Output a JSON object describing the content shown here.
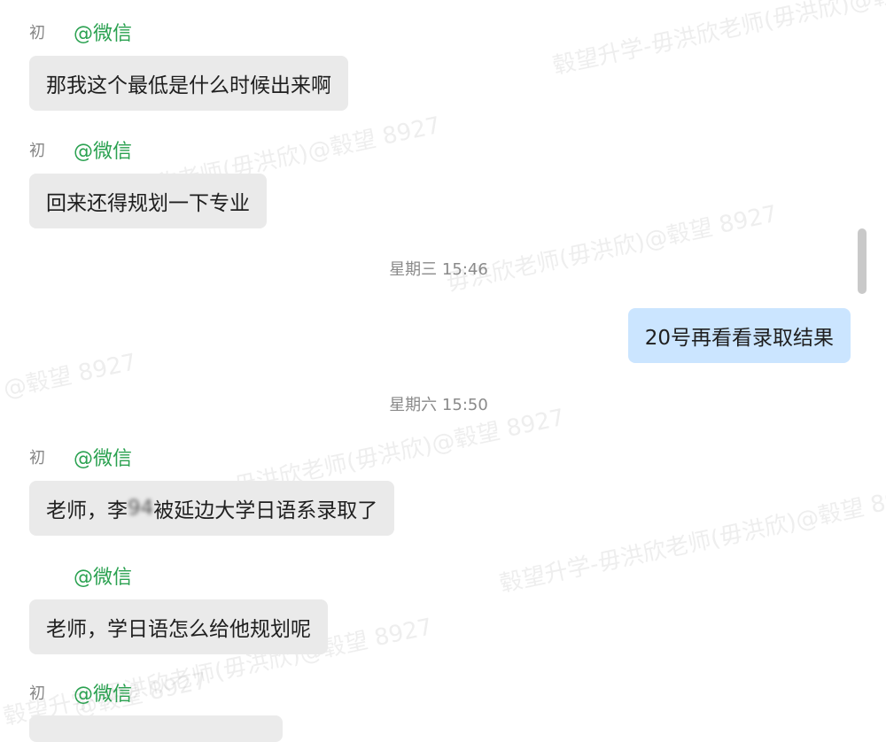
{
  "messages": [
    {
      "type": "in",
      "sender_name": "初",
      "platform": "@微信",
      "text": "那我这个最低是什么时候出来啊"
    },
    {
      "type": "in",
      "sender_name": "初",
      "platform": "@微信",
      "text": "回来还得规划一下专业"
    },
    {
      "type": "time",
      "text": "星期三 15:46"
    },
    {
      "type": "out",
      "text": "20号再看看录取结果"
    },
    {
      "type": "time",
      "text": "星期六 15:50"
    },
    {
      "type": "in",
      "sender_name": "初",
      "platform": "@微信",
      "text_prefix": "老师，李",
      "text_blurred": "94",
      "text_suffix": "被延边大学日语系录取了"
    },
    {
      "type": "in",
      "sender_name": "",
      "platform": "@微信",
      "text": "老师，学日语怎么给他规划呢"
    },
    {
      "type": "in",
      "sender_name": "初",
      "platform": "@微信"
    }
  ],
  "watermark": {
    "lines": [
      "毂望升学-毋洪欣老师(毋洪欣)@毂望 8927",
      "毋洪欣老师(毋洪欣)@毂望 8927",
      "毋洪欣老师(毋洪欣)@毂望 8927",
      "@毂望 8927",
      "毋洪欣老师(毋洪欣)@毂望 8927",
      "毂望升学-毋洪欣老师(毋洪欣)@毂望 8927",
      "毂望升学-毋洪欣老师(毋洪欣)@毂望 8927",
      "@毂望 8927"
    ]
  }
}
